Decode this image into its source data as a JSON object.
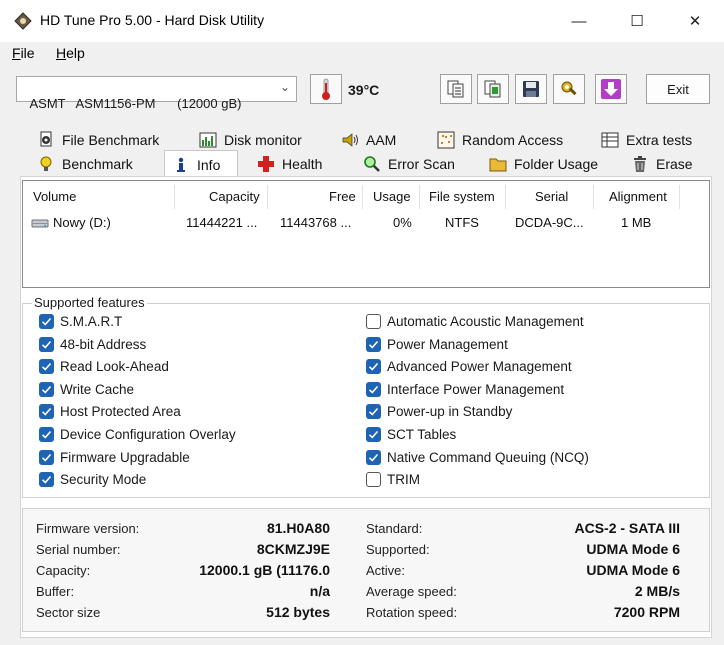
{
  "window": {
    "title": "HD Tune Pro 5.00 - Hard Disk Utility",
    "minimize": "—",
    "maximize": "☐",
    "close": "✕"
  },
  "menu": {
    "file_u": "F",
    "file_rest": "ile",
    "help_u": "H",
    "help_rest": "elp"
  },
  "toolbar": {
    "drive": "ASMT   ASM1156-PM      (12000 gB)",
    "temperature": "39°C",
    "exit_label": "Exit",
    "buttons": [
      "copy-text",
      "copy-screenshot",
      "save",
      "options",
      "download"
    ]
  },
  "tabs": {
    "row1": [
      {
        "label": "File Benchmark",
        "icon": "file-benchmark-icon"
      },
      {
        "label": "Disk monitor",
        "icon": "disk-monitor-icon"
      },
      {
        "label": "AAM",
        "icon": "speaker-icon"
      },
      {
        "label": "Random Access",
        "icon": "random-access-icon"
      },
      {
        "label": "Extra tests",
        "icon": "extra-tests-icon"
      }
    ],
    "row2": [
      {
        "label": "Benchmark",
        "icon": "bulb-icon"
      },
      {
        "label": "Info",
        "icon": "info-icon"
      },
      {
        "label": "Health",
        "icon": "health-cross-icon"
      },
      {
        "label": "Error Scan",
        "icon": "magnifier-icon"
      },
      {
        "label": "Folder Usage",
        "icon": "folder-icon"
      },
      {
        "label": "Erase",
        "icon": "trash-icon"
      }
    ],
    "active": "Info"
  },
  "volumes": {
    "headers": [
      "Volume",
      "Capacity",
      "Free",
      "Usage",
      "File system",
      "Serial",
      "Alignment"
    ],
    "rows": [
      {
        "volume": "Nowy (D:)",
        "capacity": "11444221 ...",
        "free": "11443768 ...",
        "usage": "0%",
        "fs": "NTFS",
        "serial": "DCDA-9C...",
        "alignment": "1 MB"
      }
    ]
  },
  "features": {
    "legend": "Supported features",
    "left": [
      {
        "label": "S.M.A.R.T",
        "checked": true
      },
      {
        "label": "48-bit Address",
        "checked": true
      },
      {
        "label": "Read Look-Ahead",
        "checked": true
      },
      {
        "label": "Write Cache",
        "checked": true
      },
      {
        "label": "Host Protected Area",
        "checked": true
      },
      {
        "label": "Device Configuration Overlay",
        "checked": true
      },
      {
        "label": "Firmware Upgradable",
        "checked": true
      },
      {
        "label": "Security Mode",
        "checked": true
      }
    ],
    "right": [
      {
        "label": "Automatic Acoustic Management",
        "checked": false
      },
      {
        "label": "Power Management",
        "checked": true
      },
      {
        "label": "Advanced Power Management",
        "checked": true
      },
      {
        "label": "Interface Power Management",
        "checked": true
      },
      {
        "label": "Power-up in Standby",
        "checked": true
      },
      {
        "label": "SCT Tables",
        "checked": true
      },
      {
        "label": "Native Command Queuing (NCQ)",
        "checked": true
      },
      {
        "label": "TRIM",
        "checked": false
      }
    ]
  },
  "info": {
    "left": [
      {
        "label": "Firmware version:",
        "value": "81.H0A80"
      },
      {
        "label": "Serial number:",
        "value": "8CKMZJ9E"
      },
      {
        "label": "Capacity:",
        "value": "12000.1 gB (11176.0"
      },
      {
        "label": "Buffer:",
        "value": "n/a"
      },
      {
        "label": "Sector size",
        "value": "512 bytes"
      }
    ],
    "right": [
      {
        "label": "Standard:",
        "value": "ACS-2 - SATA III"
      },
      {
        "label": "Supported:",
        "value": "UDMA Mode 6"
      },
      {
        "label": "Active:",
        "value": "UDMA Mode 6"
      },
      {
        "label": "Average speed:",
        "value": "2 MB/s"
      },
      {
        "label": "Rotation speed:",
        "value": "7200 RPM"
      }
    ]
  },
  "colors": {
    "checkbox_checked": "#1f63b5",
    "window_bg": "#f0f0f0"
  }
}
